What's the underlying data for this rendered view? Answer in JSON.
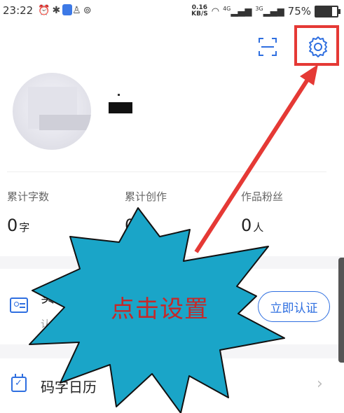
{
  "status_bar": {
    "time": "23:22",
    "net_speed_value": "0.16",
    "net_speed_unit": "KB/S",
    "signal_1": "4G",
    "signal_2": "3G",
    "battery_percent": "75%",
    "battery_level": 0.75
  },
  "profile": {},
  "stats": {
    "total_words_label": "累计字数",
    "total_words_value": "0",
    "total_words_unit": "字",
    "total_works_label": "累计创作",
    "total_works_value": "0",
    "fans_label": "作品粉丝",
    "fans_value": "0",
    "fans_unit": "人"
  },
  "verification": {
    "title": "实名",
    "subtitle": "认",
    "button_label": "立即认证"
  },
  "calendar": {
    "label": "码字日历"
  },
  "annotation": {
    "callout_text": "点击设置",
    "callout_color": "#1aa5c8",
    "highlight_color": "#e53935"
  },
  "colors": {
    "accent": "#2f6fe0"
  }
}
